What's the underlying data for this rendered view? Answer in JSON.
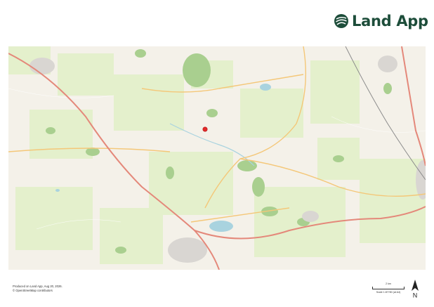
{
  "logo": {
    "text": "Land App",
    "icon": "land-app-logo-icon",
    "color": "#1d4d3a"
  },
  "map": {
    "marker_color": "#e22a2a",
    "base_color": "#f4f1e9",
    "field_color": "#e4f0cc",
    "woodland_color": "#a9cf8f",
    "water_color": "#a9d3df",
    "road_major_color": "#e4887a",
    "road_minor_color": "#f4c778"
  },
  "credits": {
    "produced": "Produced on Land App, Aug 20, 2026.",
    "osm": "© OpenStreetMap contributors"
  },
  "scale": {
    "distance": "2 km",
    "ratio": "Scale 1:87780 (at A4)"
  },
  "north": {
    "label": "N",
    "icon": "north-arrow-icon"
  }
}
